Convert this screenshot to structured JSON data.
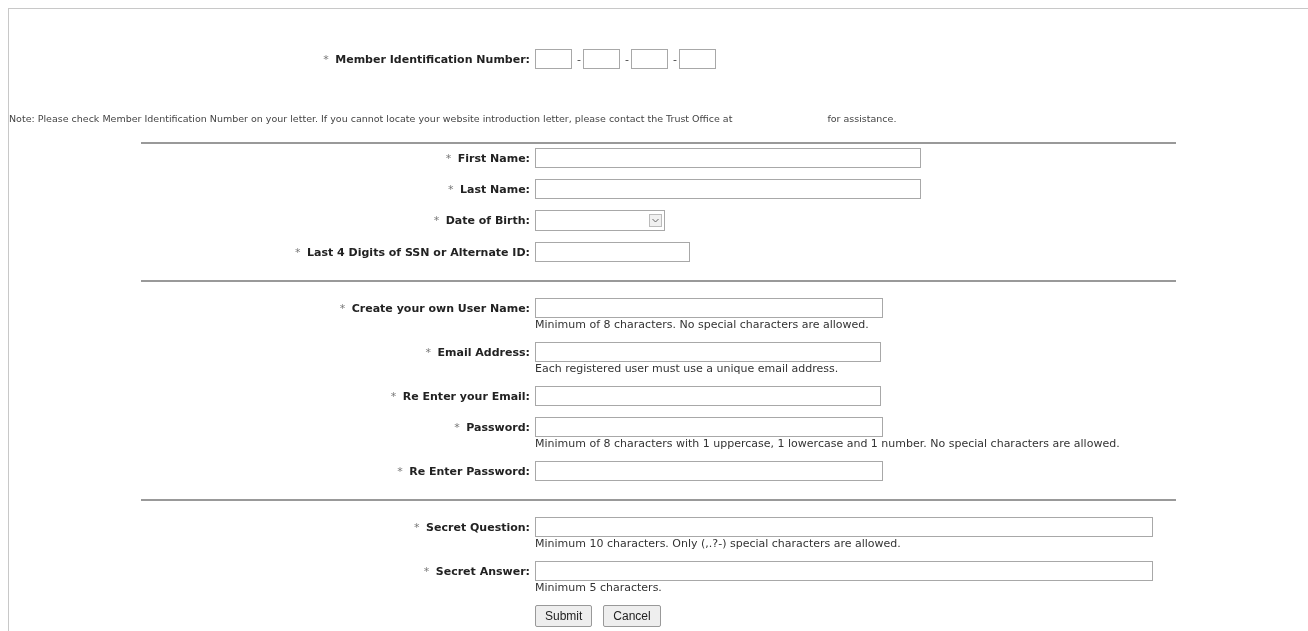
{
  "member_id": {
    "marker": "*",
    "label": "Member Identification Number:",
    "separators": [
      "-",
      "-",
      "-"
    ]
  },
  "note": {
    "text": "Note: Please check Member Identification Number on your letter. If you cannot locate your website introduction letter, please contact the Trust Office at",
    "tail": "for assistance."
  },
  "sections": [
    {
      "fields": [
        {
          "marker": "*",
          "label": "First Name:",
          "kind": "text"
        },
        {
          "marker": "*",
          "label": "Last Name:",
          "kind": "text"
        },
        {
          "marker": "*",
          "label": "Date of Birth:",
          "kind": "select"
        },
        {
          "marker": "*",
          "label": "Last 4 Digits of SSN or Alternate ID:",
          "kind": "text"
        }
      ]
    },
    {
      "fields": [
        {
          "marker": "*",
          "label": "Create your own User Name:",
          "kind": "text",
          "hint": "Minimum of 8 characters. No special characters are allowed."
        },
        {
          "marker": "*",
          "label": "Email Address:",
          "kind": "text",
          "hint": "Each registered user must use a unique email address."
        },
        {
          "marker": "*",
          "label": "Re Enter your Email:",
          "kind": "text"
        },
        {
          "marker": "*",
          "label": "Password:",
          "kind": "password",
          "hint": "Minimum of 8 characters with 1 uppercase, 1 lowercase and 1 number. No special characters are allowed."
        },
        {
          "marker": "*",
          "label": "Re Enter Password:",
          "kind": "password"
        }
      ]
    },
    {
      "fields": [
        {
          "marker": "*",
          "label": "Secret Question:",
          "kind": "text",
          "hint": "Minimum 10 characters. Only (,.?-) special characters are allowed."
        },
        {
          "marker": "*",
          "label": "Secret Answer:",
          "kind": "text",
          "hint": "Minimum 5 characters."
        }
      ]
    }
  ],
  "buttons": [
    "Submit",
    "Cancel"
  ]
}
